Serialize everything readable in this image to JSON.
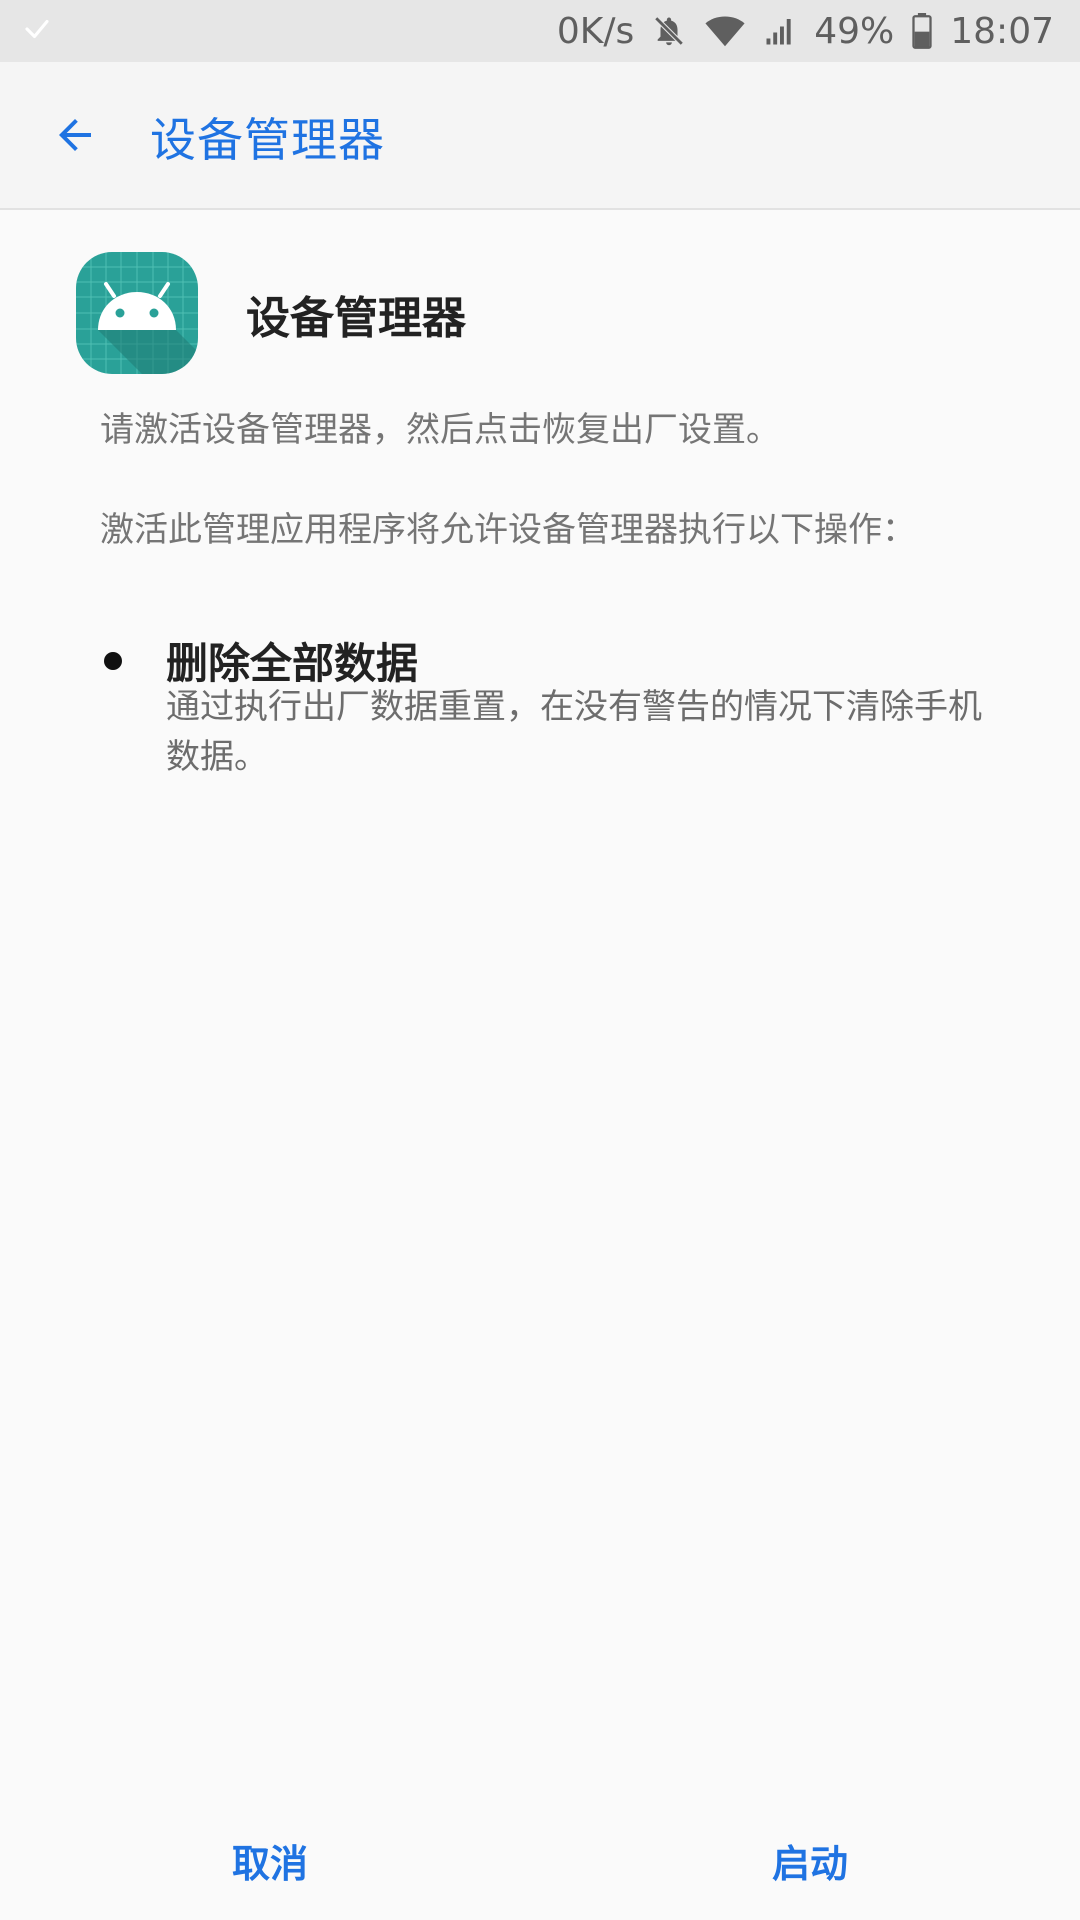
{
  "status_bar": {
    "net_speed": "0K/s",
    "battery_percent": "49%",
    "time": "18:07",
    "icons": [
      "check-icon",
      "bell-off-icon",
      "wifi-icon",
      "signal-icon",
      "battery-icon"
    ]
  },
  "app_bar": {
    "title": "设备管理器"
  },
  "header": {
    "app_name": "设备管理器",
    "icon": "android-icon",
    "icon_color": "#2aa198"
  },
  "body": {
    "intro": "请激活设备管理器，然后点击恢复出厂设置。",
    "permissions_intro": "激活此管理应用程序将允许设备管理器执行以下操作：",
    "permissions": [
      {
        "title": "删除全部数据",
        "description": "通过执行出厂数据重置，在没有警告的情况下清除手机数据。"
      }
    ]
  },
  "buttons": {
    "cancel": "取消",
    "activate": "启动"
  },
  "colors": {
    "accent": "#1f73e2",
    "background": "#fafafa",
    "status_bar": "#e6e6e6"
  }
}
